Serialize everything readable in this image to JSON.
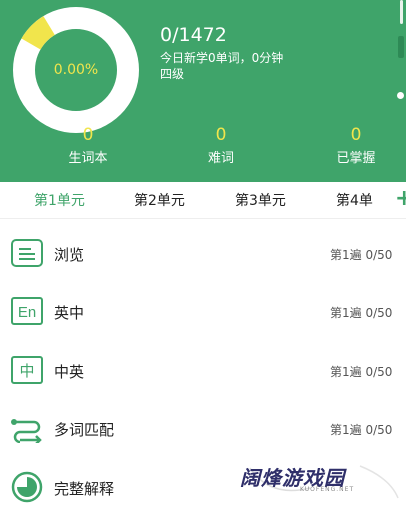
{
  "header": {
    "donut_percent_label": "0.00%",
    "donut_fill_fraction": 0.08,
    "progress_count": "0/1472",
    "today_summary": "今日新学0单词，0分钟",
    "level": "四级",
    "colors": {
      "background": "#3fa46a",
      "accent": "#f1e54c",
      "ring": "#ffffff"
    }
  },
  "stats": [
    {
      "value": "0",
      "label": "生词本"
    },
    {
      "value": "0",
      "label": "难词"
    },
    {
      "value": "0",
      "label": "已掌握"
    }
  ],
  "tabs": {
    "items": [
      "第1单元",
      "第2单元",
      "第3单元",
      "第4单"
    ],
    "active_index": 0,
    "add_icon": "plus-icon"
  },
  "modes": [
    {
      "label": "浏览",
      "meta": "第1遍 0/50",
      "icon": "document-icon"
    },
    {
      "label": "英中",
      "meta": "第1遍 0/50",
      "icon": "en-icon",
      "icon_text": "En"
    },
    {
      "label": "中英",
      "meta": "第1遍 0/50",
      "icon": "zh-icon",
      "icon_text": "中"
    },
    {
      "label": "多词匹配",
      "meta": "第1遍 0/50",
      "icon": "match-icon"
    },
    {
      "label": "完整解释",
      "meta": "",
      "icon": "pie-icon"
    }
  ],
  "watermark": {
    "text": "阔烽游戏园",
    "subtext": "KUOFENG.NET"
  }
}
